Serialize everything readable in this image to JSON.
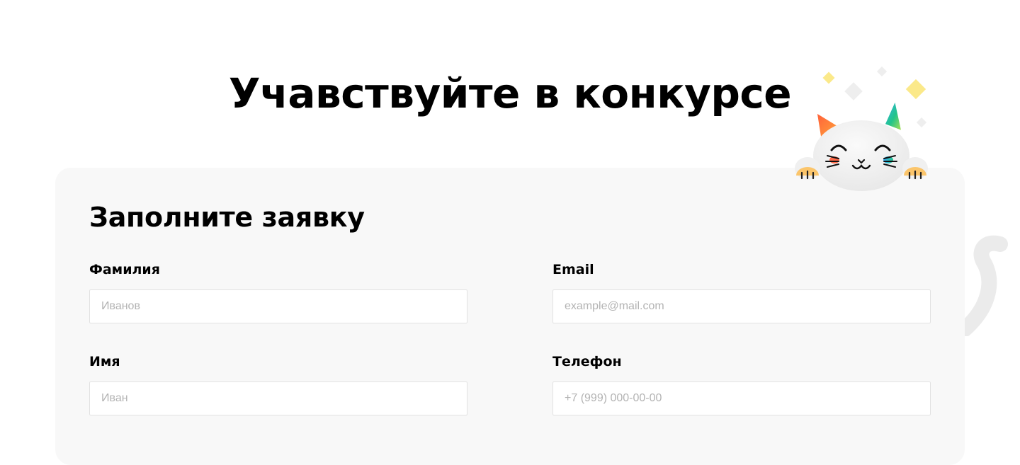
{
  "page": {
    "title": "Учавствуйте в конкурсе"
  },
  "form": {
    "title": "Заполните заявку",
    "fields": {
      "surname": {
        "label": "Фамилия",
        "placeholder": "Иванов"
      },
      "email": {
        "label": "Email",
        "placeholder": "example@mail.com"
      },
      "name": {
        "label": "Имя",
        "placeholder": "Иван"
      },
      "phone": {
        "label": "Телефон",
        "placeholder": "+7 (999) 000-00-00"
      }
    }
  },
  "icons": [
    "cat-mascot-icon",
    "sparkle-icon",
    "cat-tail-icon"
  ],
  "colors": {
    "card_background": "#f8f8f8",
    "input_border": "#e2e2e2",
    "placeholder": "#b3b3b3",
    "sparkle_yellow": "#fbe98a"
  }
}
